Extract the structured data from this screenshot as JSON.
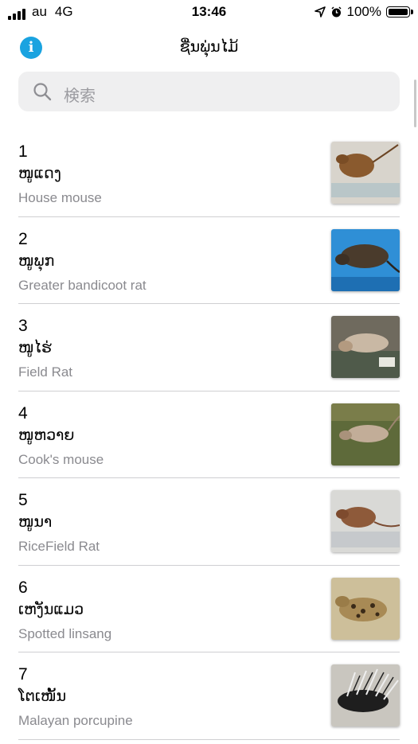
{
  "status_bar": {
    "carrier": "au",
    "network": "4G",
    "time": "13:46",
    "battery": "100%",
    "battery_level": 1.0
  },
  "nav": {
    "title": "ຊື່ນພຸ່ນໄມ້",
    "info_icon": "info-icon"
  },
  "search": {
    "placeholder": "検索"
  },
  "items": [
    {
      "num": "1",
      "lao": "ໜູແດງ",
      "english": "House mouse"
    },
    {
      "num": "2",
      "lao": "ໜູພຸກ",
      "english": "Greater bandicoot rat"
    },
    {
      "num": "3",
      "lao": "ໜູໄຮ່",
      "english": "Field Rat"
    },
    {
      "num": "4",
      "lao": "ໜູຫວາຍ",
      "english": "Cook's mouse"
    },
    {
      "num": "5",
      "lao": "ໜູນາ",
      "english": "RiceField Rat"
    },
    {
      "num": "6",
      "lao": "ເຫງັນແມວ",
      "english": "Spotted linsang"
    },
    {
      "num": "7",
      "lao": "ໂຕເໜັ້ນ",
      "english": "Malayan porcupine"
    }
  ]
}
